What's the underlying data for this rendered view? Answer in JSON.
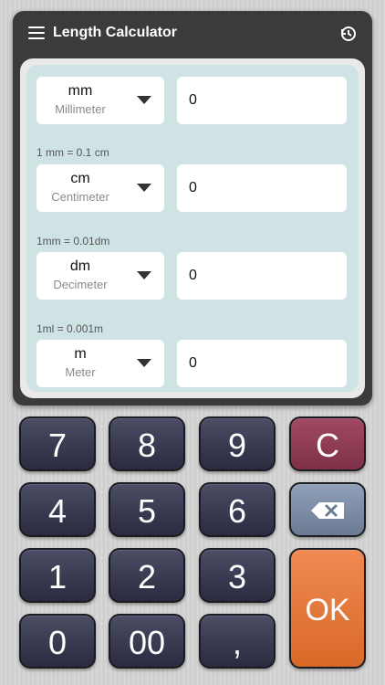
{
  "header": {
    "title": "Length Calculator",
    "menu_icon": "menu-icon",
    "history_icon": "history-icon"
  },
  "converter": {
    "rows": [
      {
        "abbr": "mm",
        "name": "Millimeter",
        "value": "0"
      },
      {
        "abbr": "cm",
        "name": "Centimeter",
        "value": "0"
      },
      {
        "abbr": "dm",
        "name": "Decimeter",
        "value": "0"
      },
      {
        "abbr": "m",
        "name": "Meter",
        "value": "0"
      }
    ],
    "notes": [
      "1 mm = 0.1 cm",
      "1mm = 0.01dm",
      "1ml = 0.001m"
    ]
  },
  "keypad": {
    "k7": "7",
    "k8": "8",
    "k9": "9",
    "clear": "C",
    "k4": "4",
    "k5": "5",
    "k6": "6",
    "k1": "1",
    "k2": "2",
    "k3": "3",
    "ok": "OK",
    "k0": "0",
    "k00": "00",
    "comma": ","
  },
  "colors": {
    "key_dark": "#3a3b52",
    "key_clear": "#8e3b55",
    "key_backspace": "#7d8ea6",
    "key_ok": "#e5783b",
    "panel_bg": "#cfe3e5",
    "header_bg": "#3b3b3b"
  }
}
